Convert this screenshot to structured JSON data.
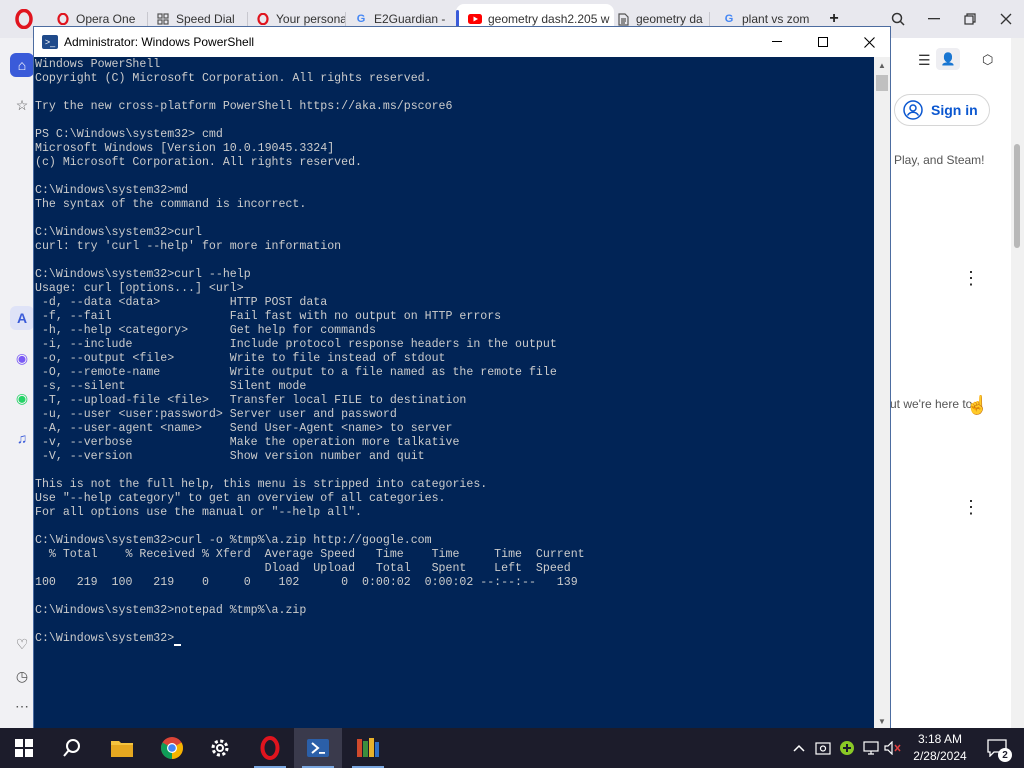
{
  "browser": {
    "tabs": [
      {
        "label": "Opera One",
        "icon": "opera-icon"
      },
      {
        "label": "Speed Dial",
        "icon": "speed-dial-icon"
      },
      {
        "label": "Your persona",
        "icon": "opera-icon"
      },
      {
        "label": "E2Guardian -",
        "icon": "google-icon"
      },
      {
        "label": "geometry dash2.205 w",
        "icon": "youtube-icon"
      },
      {
        "label": "geometry da",
        "icon": "document-icon"
      },
      {
        "label": "plant vs zom",
        "icon": "google-icon"
      }
    ],
    "new_tab_label": "+"
  },
  "webpage": {
    "sign_in": "Sign in",
    "snippet_1": "Play, and Steam!",
    "snippet_2": "ut we're here to"
  },
  "powershell": {
    "title": "Administrator: Windows PowerShell",
    "console_lines": [
      "Windows PowerShell",
      "Copyright (C) Microsoft Corporation. All rights reserved.",
      "",
      "Try the new cross-platform PowerShell https://aka.ms/pscore6",
      "",
      "PS C:\\Windows\\system32> cmd",
      "Microsoft Windows [Version 10.0.19045.3324]",
      "(c) Microsoft Corporation. All rights reserved.",
      "",
      "C:\\Windows\\system32>md",
      "The syntax of the command is incorrect.",
      "",
      "C:\\Windows\\system32>curl",
      "curl: try 'curl --help' for more information",
      "",
      "C:\\Windows\\system32>curl --help",
      "Usage: curl [options...] <url>",
      " -d, --data <data>          HTTP POST data",
      " -f, --fail                 Fail fast with no output on HTTP errors",
      " -h, --help <category>      Get help for commands",
      " -i, --include              Include protocol response headers in the output",
      " -o, --output <file>        Write to file instead of stdout",
      " -O, --remote-name          Write output to a file named as the remote file",
      " -s, --silent               Silent mode",
      " -T, --upload-file <file>   Transfer local FILE to destination",
      " -u, --user <user:password> Server user and password",
      " -A, --user-agent <name>    Send User-Agent <name> to server",
      " -v, --verbose              Make the operation more talkative",
      " -V, --version              Show version number and quit",
      "",
      "This is not the full help, this menu is stripped into categories.",
      "Use \"--help category\" to get an overview of all categories.",
      "For all options use the manual or \"--help all\".",
      "",
      "C:\\Windows\\system32>curl -o %tmp%\\a.zip http://google.com",
      "  % Total    % Received % Xferd  Average Speed   Time    Time     Time  Current",
      "                                 Dload  Upload   Total   Spent    Left  Speed",
      "100   219  100   219    0     0    102      0  0:00:02  0:00:02 --:--:--   139",
      "",
      "C:\\Windows\\system32>notepad %tmp%\\a.zip",
      "",
      "C:\\Windows\\system32>"
    ]
  },
  "taskbar": {
    "time": "3:18 AM",
    "date": "2/28/2024",
    "notification_count": "2"
  },
  "colors": {
    "console_bg": "#012456",
    "console_fg": "#cccccc",
    "taskbar_bg": "#1c1c2b",
    "opera_red": "#e0141e"
  }
}
